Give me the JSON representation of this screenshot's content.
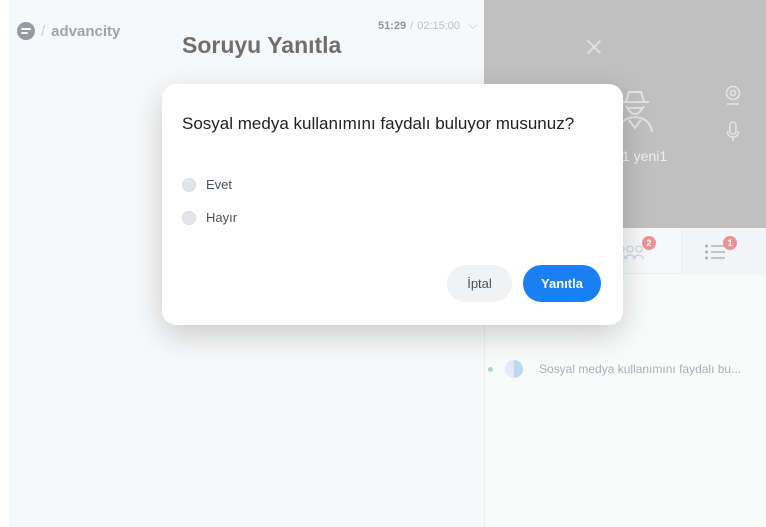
{
  "brand": {
    "separator": "/",
    "name": "advancity"
  },
  "header": {
    "title": "Soruyu Yanıtla"
  },
  "timer": {
    "elapsed": "51:29",
    "separator": " / ",
    "total": "02:15:00"
  },
  "video": {
    "participant_name": "1 yeni1"
  },
  "tabs": {
    "people_badge": "2",
    "questions_badge": "1"
  },
  "questions_list": [
    {
      "text": "Sosyal medya kullanımını faydalı bu..."
    }
  ],
  "modal": {
    "question": "Sosyal medya kullanımını faydalı buluyor musunuz?",
    "options": [
      {
        "label": "Evet"
      },
      {
        "label": "Hayır"
      }
    ],
    "cancel_label": "İptal",
    "submit_label": "Yanıtla"
  },
  "colors": {
    "primary": "#1a7ff0",
    "badge": "#e05a5a",
    "status_dot": "#7fc59b"
  }
}
